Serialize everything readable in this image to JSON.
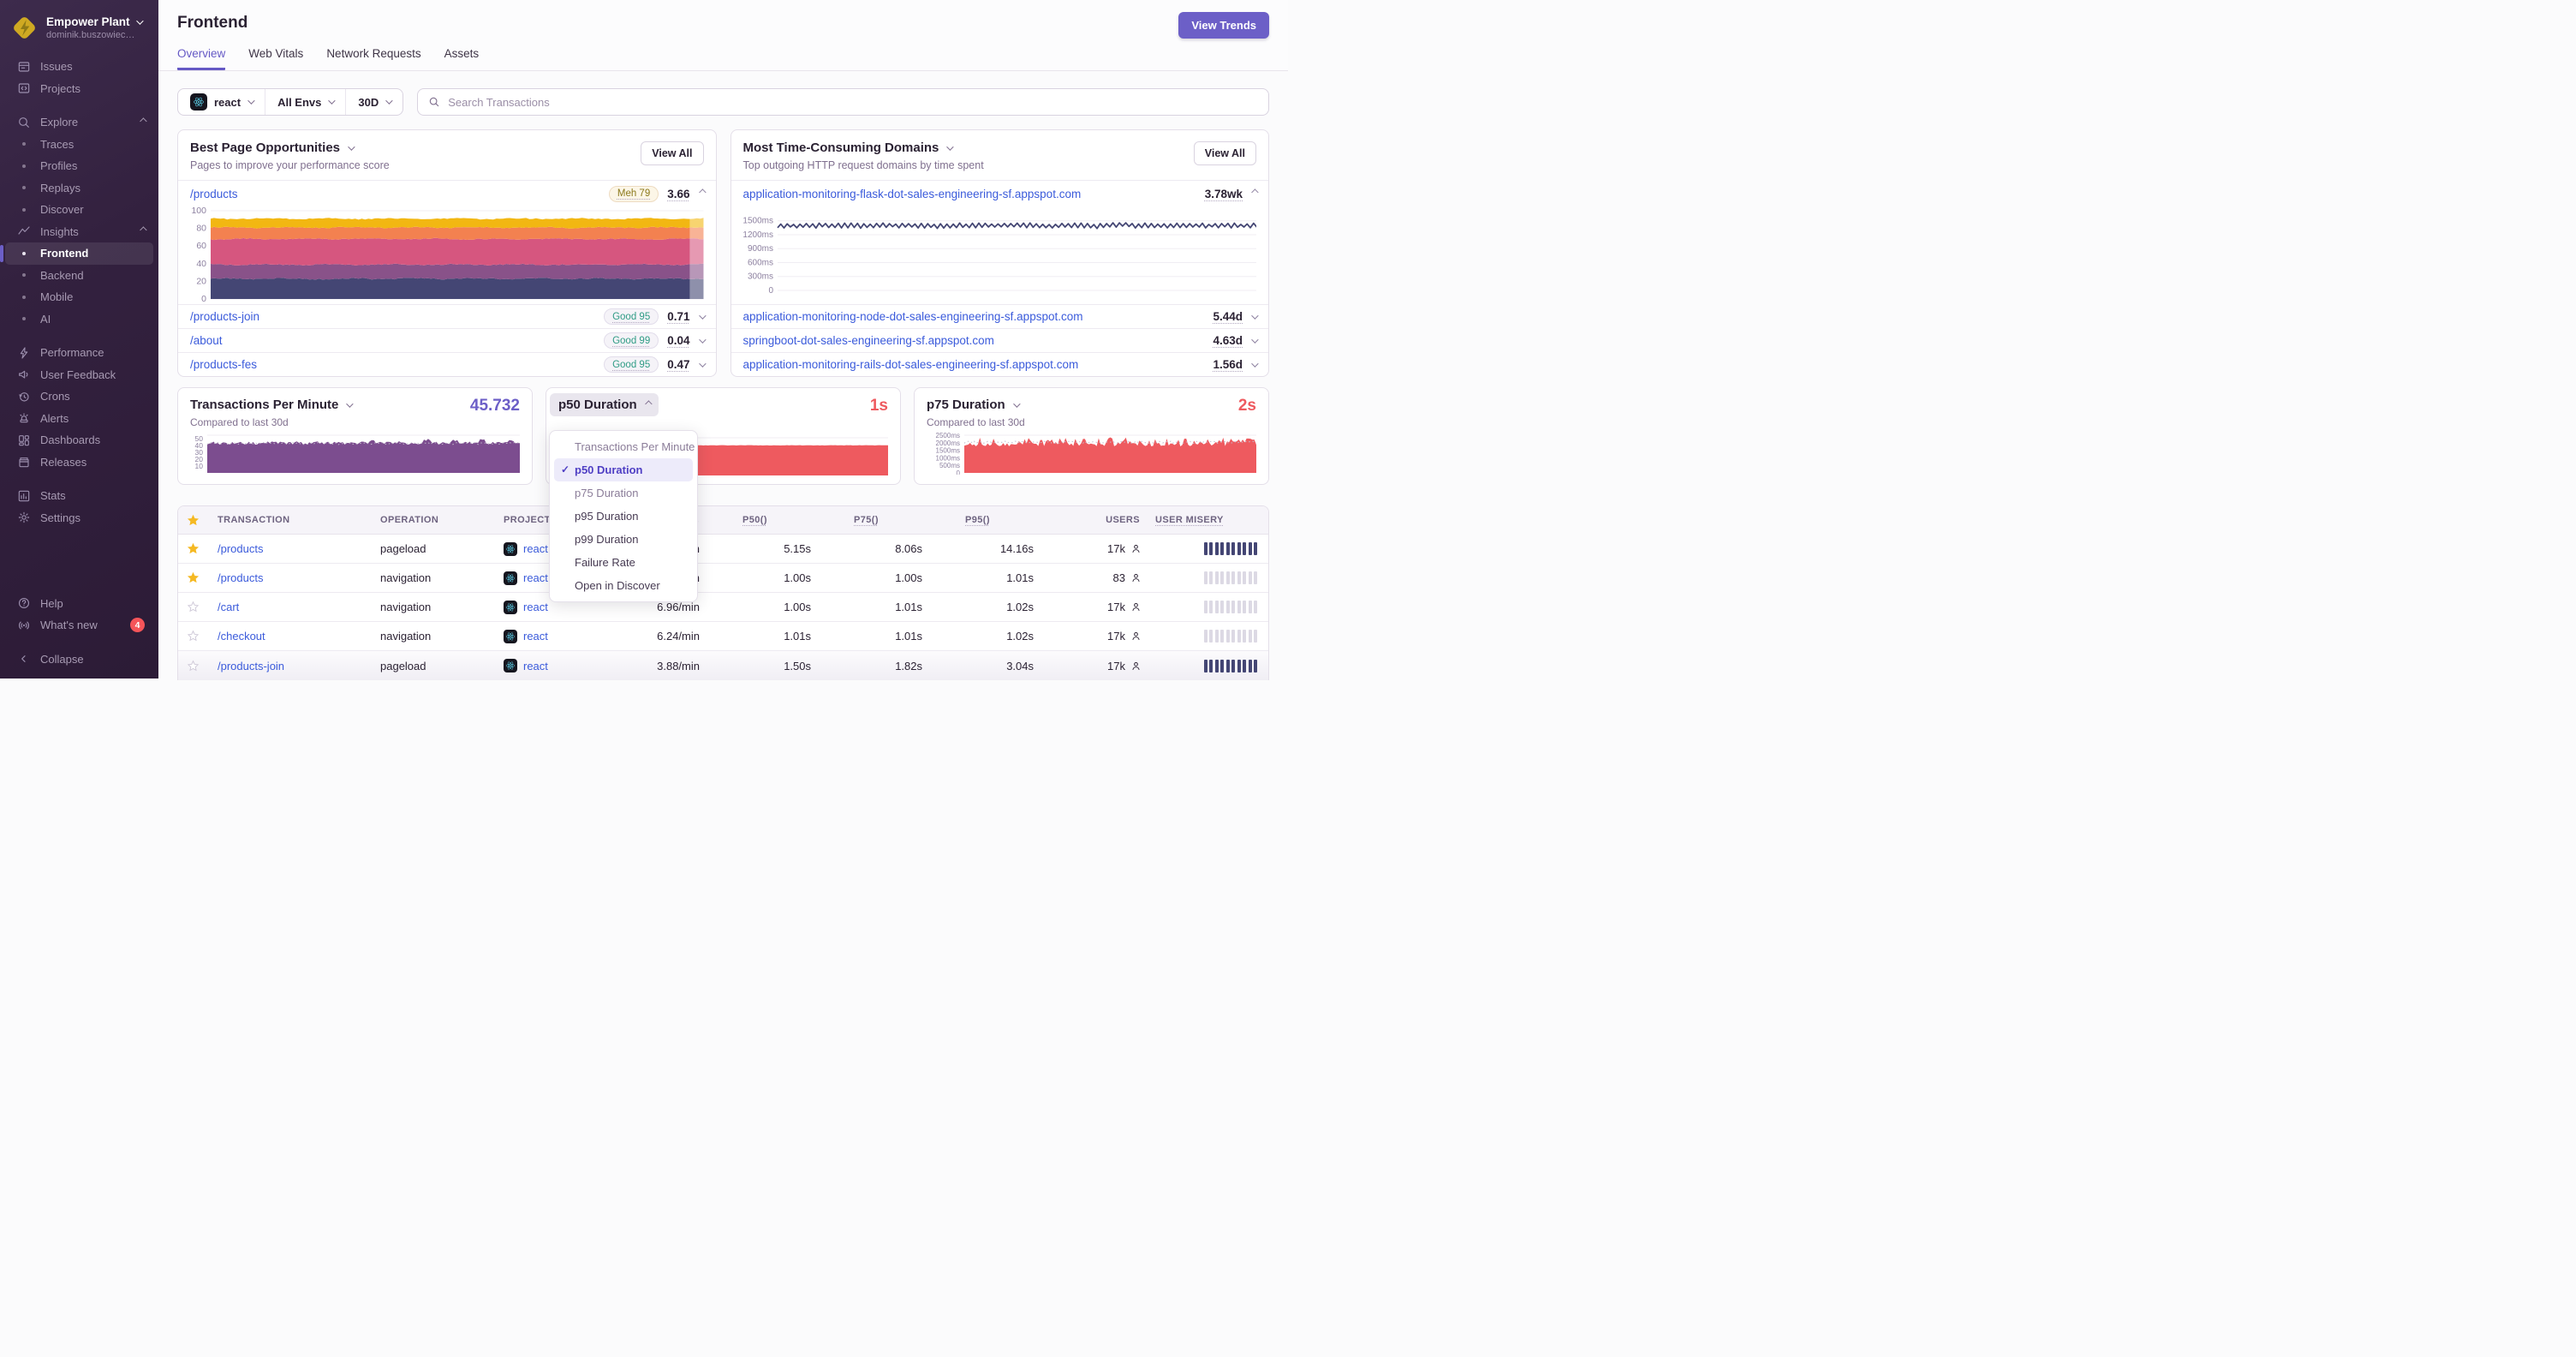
{
  "colors": {
    "accent": "#6C5FC7",
    "tab_active": "#6559C5",
    "link": "#3B5BDB",
    "red": "#EE5A5F",
    "navy": "#444674",
    "chart_purple": "#7C4D8F",
    "star_yellow": "#F5B923",
    "badge_red": "#F55459",
    "good_green": "#2F9C85",
    "meh_olive": "#8C7A1C"
  },
  "sidebar": {
    "org": {
      "name": "Empower Plant",
      "user": "dominik.buszowiec…"
    },
    "items": [
      {
        "label": "Issues",
        "icon": "issues"
      },
      {
        "label": "Projects",
        "icon": "projects"
      },
      {
        "label": "Explore",
        "icon": "search",
        "chevron": "up",
        "gap": true
      },
      {
        "label": "Traces",
        "bullet": true
      },
      {
        "label": "Profiles",
        "bullet": true
      },
      {
        "label": "Replays",
        "bullet": true
      },
      {
        "label": "Discover",
        "bullet": true
      },
      {
        "label": "Insights",
        "icon": "insights",
        "chevron": "up"
      },
      {
        "label": "Frontend",
        "bullet": true,
        "active": true
      },
      {
        "label": "Backend",
        "bullet": true
      },
      {
        "label": "Mobile",
        "bullet": true
      },
      {
        "label": "AI",
        "bullet": true
      },
      {
        "label": "Performance",
        "icon": "performance",
        "gap": true
      },
      {
        "label": "User Feedback",
        "icon": "feedback"
      },
      {
        "label": "Crons",
        "icon": "crons"
      },
      {
        "label": "Alerts",
        "icon": "alerts"
      },
      {
        "label": "Dashboards",
        "icon": "dashboards"
      },
      {
        "label": "Releases",
        "icon": "releases"
      },
      {
        "label": "Stats",
        "icon": "stats",
        "gap": true
      },
      {
        "label": "Settings",
        "icon": "settings"
      }
    ],
    "footer": [
      {
        "label": "Help",
        "icon": "help"
      },
      {
        "label": "What's new",
        "icon": "broadcast",
        "badge": "4"
      },
      {
        "label": "Collapse",
        "icon": "collapse",
        "gap": true
      }
    ]
  },
  "header": {
    "title": "Frontend",
    "cta": "View Trends",
    "tabs": [
      {
        "label": "Overview",
        "active": true
      },
      {
        "label": "Web Vitals"
      },
      {
        "label": "Network Requests"
      },
      {
        "label": "Assets"
      }
    ]
  },
  "filters": {
    "project": "react",
    "env": "All Envs",
    "period": "30D",
    "search_placeholder": "Search Transactions"
  },
  "panels": {
    "best_pages": {
      "title": "Best Page Opportunities",
      "subtitle": "Pages to improve your performance score",
      "view_all": "View All",
      "expanded": {
        "path": "/products",
        "badge": "Meh 79",
        "value": "3.66"
      },
      "rows": [
        {
          "path": "/products-join",
          "badge": "Good 95",
          "value": "0.71"
        },
        {
          "path": "/about",
          "badge": "Good 99",
          "value": "0.04"
        },
        {
          "path": "/products-fes",
          "badge": "Good 95",
          "value": "0.47"
        }
      ]
    },
    "domains": {
      "title": "Most Time-Consuming Domains",
      "subtitle": "Top outgoing HTTP request domains by time spent",
      "view_all": "View All",
      "expanded": {
        "domain": "application-monitoring-flask-dot-sales-engineering-sf.appspot.com",
        "value": "3.78wk"
      },
      "rows": [
        {
          "domain": "application-monitoring-node-dot-sales-engineering-sf.appspot.com",
          "value": "5.44d"
        },
        {
          "domain": "springboot-dot-sales-engineering-sf.appspot.com",
          "value": "4.63d"
        },
        {
          "domain": "application-monitoring-rails-dot-sales-engineering-sf.appspot.com",
          "value": "1.56d"
        }
      ]
    }
  },
  "metrics": {
    "tpm": {
      "title": "Transactions Per Minute",
      "value": "45.732",
      "subtitle": "Compared to last 30d"
    },
    "p50": {
      "title": "p50 Duration",
      "value": "1s"
    },
    "p75": {
      "title": "p75 Duration",
      "value": "2s",
      "subtitle": "Compared to last 30d"
    }
  },
  "dropdown": {
    "items": [
      {
        "label": "Transactions Per Minute",
        "muted": true
      },
      {
        "label": "p50 Duration",
        "selected": true
      },
      {
        "label": "p75 Duration",
        "muted": true
      },
      {
        "label": "p95 Duration"
      },
      {
        "label": "p99 Duration"
      },
      {
        "label": "Failure Rate"
      },
      {
        "label": "Open in Discover"
      }
    ]
  },
  "table": {
    "columns": {
      "transaction": "TRANSACTION",
      "operation": "OPERATION",
      "project": "PROJECT",
      "sort_arrow": "↓",
      "p50": "P50()",
      "p75": "P75()",
      "p95": "P95()",
      "users": "USERS",
      "misery": "USER MISERY"
    },
    "rows": [
      {
        "starred": true,
        "transaction": "/products",
        "operation": "pageload",
        "project": "react",
        "tpm": "/min",
        "p50": "5.15s",
        "p75": "8.06s",
        "p95": "14.16s",
        "users": "17k",
        "misery_high": true
      },
      {
        "starred": true,
        "transaction": "/products",
        "operation": "navigation",
        "project": "react",
        "tpm": "/min",
        "p50": "1.00s",
        "p75": "1.00s",
        "p95": "1.01s",
        "users": "83"
      },
      {
        "transaction": "/cart",
        "operation": "navigation",
        "project": "react",
        "tpm": "6.96/min",
        "p50": "1.00s",
        "p75": "1.01s",
        "p95": "1.02s",
        "users": "17k"
      },
      {
        "transaction": "/checkout",
        "operation": "navigation",
        "project": "react",
        "tpm": "6.24/min",
        "p50": "1.01s",
        "p75": "1.01s",
        "p95": "1.02s",
        "users": "17k"
      },
      {
        "transaction": "/products-join",
        "operation": "pageload",
        "project": "react",
        "tpm": "3.88/min",
        "p50": "1.50s",
        "p75": "1.82s",
        "p95": "3.04s",
        "users": "17k",
        "misery_high": true
      }
    ]
  },
  "chart_data": [
    {
      "id": "best-pages",
      "type": "stacked_area",
      "title": "Best Page Opportunities — /products score breakdown",
      "ylim": [
        0,
        100
      ],
      "yticks": [
        {
          "v": 100,
          "label": "100"
        },
        {
          "v": 80,
          "label": "80"
        },
        {
          "v": 60,
          "label": "60"
        },
        {
          "v": 40,
          "label": "40"
        },
        {
          "v": 20,
          "label": "20"
        },
        {
          "v": 0,
          "label": "0"
        }
      ],
      "series": [
        {
          "color": "#444674",
          "level": 23
        },
        {
          "color": "#895289",
          "level": 39
        },
        {
          "color": "#D6567F",
          "level": 68
        },
        {
          "color": "#F38150",
          "level": 81
        },
        {
          "color": "#F2B712",
          "level": 91
        }
      ],
      "axis_w": 30,
      "fs": 10.5,
      "pad_top": 5,
      "pad_bottom": 4,
      "grid": true
    },
    {
      "id": "domains",
      "type": "line",
      "title": "Most Time-Consuming Domains — flask appspot",
      "color": "#444674",
      "ylim": [
        0,
        1550
      ],
      "base": 1400,
      "zig": 55,
      "yticks": [
        {
          "v": 1500,
          "label": "1500ms"
        },
        {
          "v": 1200,
          "label": "1200ms"
        },
        {
          "v": 900,
          "label": "900ms"
        },
        {
          "v": 600,
          "label": "600ms"
        },
        {
          "v": 300,
          "label": "300ms"
        },
        {
          "v": 0,
          "label": "0"
        }
      ],
      "axis_w": 46,
      "fs": 10,
      "pad_top": 14,
      "pad_bottom": 14,
      "grid": true
    },
    {
      "id": "tpm",
      "type": "area",
      "title": "Transactions Per Minute",
      "color": "#7C4D8F",
      "ylim": [
        0,
        55
      ],
      "base": 43.5,
      "noise": 2.4,
      "right_peaks": 8,
      "prev": {
        "base": 43,
        "noise": 1.6
      },
      "yticks": [
        {
          "v": 50,
          "label": "50"
        },
        {
          "v": 40,
          "label": "40"
        },
        {
          "v": 30,
          "label": "30"
        },
        {
          "v": 20,
          "label": "20"
        },
        {
          "v": 10,
          "label": "10"
        }
      ],
      "axis_w": 20,
      "fs": 8.5,
      "pad_top": 4,
      "pad_bottom": 2,
      "grid": false,
      "grid_top": true
    },
    {
      "id": "p50",
      "type": "area",
      "title": "p50 Duration",
      "color": "#EE5A5F",
      "ylim": [
        0,
        1250
      ],
      "base": 1000,
      "noise": 7,
      "spikes": [
        [
          0.37,
          1170
        ],
        [
          0.965,
          1100
        ]
      ],
      "yticks": [],
      "axis_w": 0,
      "pad_top": 4,
      "pad_bottom": 2,
      "grid": false,
      "grid_top": true
    },
    {
      "id": "p75",
      "type": "area",
      "title": "p75 Duration",
      "color": "#EE5A5F",
      "ylim": [
        0,
        2500
      ],
      "base": 1880,
      "noise": 120,
      "spiky": 400,
      "prev": {
        "base": 2030,
        "noise": 80
      },
      "yticks": [
        {
          "v": 2500,
          "label": "2500ms"
        },
        {
          "v": 2000,
          "label": "2000ms"
        },
        {
          "v": 1500,
          "label": "1500ms"
        },
        {
          "v": 1000,
          "label": "1000ms"
        },
        {
          "v": 500,
          "label": "500ms"
        },
        {
          "v": 0,
          "label": "0"
        }
      ],
      "axis_w": 44,
      "fs": 8,
      "pad_top": 4,
      "pad_bottom": 2,
      "grid": false,
      "grid_top": true
    }
  ]
}
